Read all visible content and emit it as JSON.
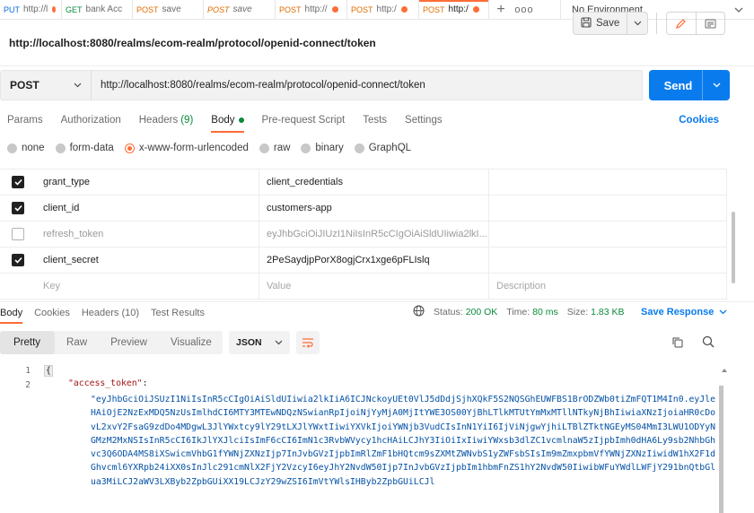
{
  "tabs": [
    {
      "method": "PUT",
      "name": "http://l",
      "italic": false,
      "dirty": true
    },
    {
      "method": "GET",
      "name": "bank Acc",
      "italic": false,
      "dirty": false
    },
    {
      "method": "POST",
      "name": "save",
      "italic": false,
      "dirty": false
    },
    {
      "method": "POST",
      "name": "save",
      "italic": true,
      "dirty": false
    },
    {
      "method": "POST",
      "name": "http://",
      "italic": false,
      "dirty": true
    },
    {
      "method": "POST",
      "name": "http:/",
      "italic": false,
      "dirty": true
    },
    {
      "method": "POST",
      "name": "http:/",
      "italic": false,
      "dirty": true,
      "active": true
    }
  ],
  "tab_new": "+",
  "tab_more": "ooo",
  "environment": "No Environment",
  "request_title": "http://localhost:8080/realms/ecom-realm/protocol/openid-connect/token",
  "toolbar": {
    "save_label": "Save"
  },
  "url_bar": {
    "method": "POST",
    "url": "http://localhost:8080/realms/ecom-realm/protocol/openid-connect/token",
    "send_label": "Send"
  },
  "request_tabs": [
    {
      "label": "Params"
    },
    {
      "label": "Authorization"
    },
    {
      "label": "Headers",
      "count": "(9)"
    },
    {
      "label": "Body",
      "active": true
    },
    {
      "label": "Pre-request Script"
    },
    {
      "label": "Tests"
    },
    {
      "label": "Settings"
    }
  ],
  "cookies_label": "Cookies",
  "body_types": [
    "none",
    "form-data",
    "x-www-form-urlencoded",
    "raw",
    "binary",
    "GraphQL"
  ],
  "body_type_selected": "x-www-form-urlencoded",
  "params": [
    {
      "checked": true,
      "key": "grant_type",
      "value": "client_credentials",
      "description": ""
    },
    {
      "checked": true,
      "key": "client_id",
      "value": "customers-app",
      "description": ""
    },
    {
      "checked": false,
      "key": "refresh_token",
      "value": "eyJhbGciOiJIUzI1NiIsInR5cCIgOiAiSldUIiwia2lkI...",
      "description": ""
    },
    {
      "checked": true,
      "key": "client_secret",
      "value": "2PeSaydjpPorX8ogjCrx1xge6pFLIslq",
      "description": ""
    }
  ],
  "params_placeholder": {
    "key": "Key",
    "value": "Value",
    "description": "Description"
  },
  "response_tabs": [
    "Body",
    "Cookies",
    "Headers",
    "Test Results"
  ],
  "response_headers_count": "(10)",
  "status": {
    "status_label": "Status:",
    "status_value": "200 OK",
    "time_label": "Time:",
    "time_value": "80 ms",
    "size_label": "Size:",
    "size_value": "1.83 KB"
  },
  "save_response_label": "Save Response",
  "view_modes": [
    "Pretty",
    "Raw",
    "Preview",
    "Visualize"
  ],
  "view_mode_selected": "Pretty",
  "format": "JSON",
  "code": {
    "line_numbers": [
      "1",
      "2"
    ],
    "open_brace": "{",
    "key": "\"access_token\"",
    "colon": ":",
    "token": "\"eyJhbGciOiJSUzI1NiIsInR5cCIgOiAiSldUIiwia2lkIiA6ICJNckoyUEt0VlJ5dDdjSjhXQkF5S2NQSGhEUWFBS1BrODZWb0tiZmFQT1M4In0.eyJleHAiOjE2NzExMDQ5NzUsImlhdCI6MTY3MTEwNDQzNSwianRpIjoiNjYyMjA0MjItYWE3OS00YjBhLTlkMTUtYmMxMTllNTkyNjBhIiwiaXNzIjoiaHR0cDovL2xvY2FsaG9zdDo4MDgwL3JlYWxtcy9lY29tLXJlYWxtIiwiYXVkIjoiYWNjb3VudCIsInN1YiI6IjViNjgwYjhiLTBlZTktNGEyMS04MmI3LWU1ODYyNGMzM2MxNSIsInR5cCI6IkJlYXJlciIsImF6cCI6ImN1c3RvbWVycy1hcHAiLCJhY3IiOiIxIiwiYWxsb3dlZC1vcmlnaW5zIjpbImh0dHA6Ly9sb2NhbGhvc3Q6ODA4MS8iXSwicmVhbG1fYWNjZXNzIjp7InJvbGVzIjpbImRlZmF1bHQtcm9sZXMtZWNvbS1yZWFsbSIsIm9mZmxpbmVfYWNjZXNzIiwidW1hX2F1dGhvcml6YXRpb24iXX0sInJlc291cmNlX2FjY2VzcyI6eyJhY2NvdW50Ijp7InJvbGVzIjpbIm1hbmFnZS1hY2NvdW50IiwibWFuYWdlLWFjY291bnQtbGlua3MiLCJ2aWV3LXByb2ZpbGUiXX19LCJzY29wZSI6ImVtYWlsIHByb2ZpbGUiLCJl"
  },
  "colors": {
    "accent": "#ff6c37",
    "send": "#097bed",
    "ok": "#0b8a3b",
    "json_key": "#a31515",
    "json_string": "#0451a5"
  }
}
